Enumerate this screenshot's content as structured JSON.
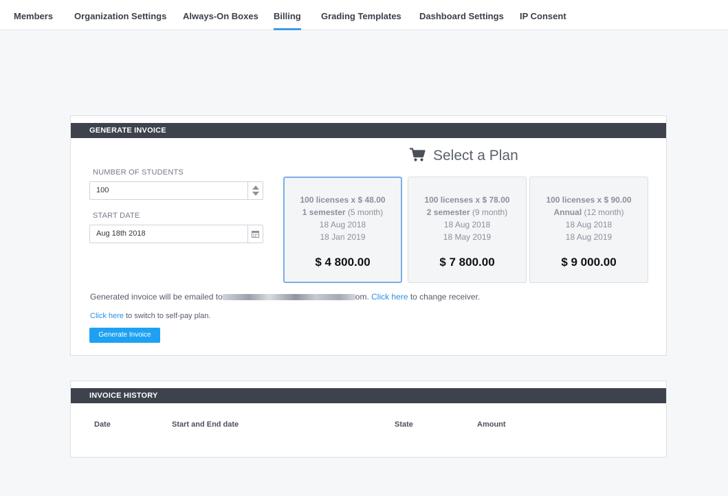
{
  "nav": {
    "tabs": [
      {
        "label": "Members"
      },
      {
        "label": "Organization Settings"
      },
      {
        "label": "Always-On Boxes"
      },
      {
        "label": "Billing",
        "active": true
      },
      {
        "label": "Grading Templates"
      },
      {
        "label": "Dashboard Settings"
      },
      {
        "label": "IP Consent"
      }
    ]
  },
  "generate_invoice": {
    "header": "GENERATE INVOICE",
    "students_label": "NUMBER OF STUDENTS",
    "students_value": "100",
    "start_date_label": "START DATE",
    "start_date_value": "Aug 18th 2018",
    "select_plan_title": "Select a Plan",
    "plans": [
      {
        "licenses": "100 licenses x $ 48.00",
        "term": "1 semester",
        "term_note": " (5 month)",
        "start": "18 Aug 2018",
        "end": "18 Jan 2019",
        "price": "$ 4 800.00",
        "selected": true
      },
      {
        "licenses": "100 licenses x $ 78.00",
        "term": "2 semester",
        "term_note": " (9 month)",
        "start": "18 Aug 2018",
        "end": "18 May 2019",
        "price": "$ 7 800.00",
        "selected": false
      },
      {
        "licenses": "100 licenses x $ 90.00",
        "term": "Annual",
        "term_note": " (12 month)",
        "start": "18 Aug 2018",
        "end": "18 Aug 2019",
        "price": "$ 9 000.00",
        "selected": false
      }
    ],
    "email_prefix": "Generated invoice will be emailed to",
    "email_suffix": "om.",
    "click_here_receiver": "Click here",
    "receiver_suffix": " to change receiver.",
    "click_here_selfpay": "Click here",
    "selfpay_suffix": " to switch to self-pay plan.",
    "generate_button": "Generate Invoice"
  },
  "invoice_history": {
    "header": "INVOICE HISTORY",
    "columns": [
      "Date",
      "Start and End date",
      "State",
      "Amount"
    ]
  },
  "icons": {
    "cart": "shopping-cart-icon",
    "calendar": "calendar-icon",
    "spinner": "number-stepper-icon"
  },
  "colors": {
    "accent": "#3d9be9",
    "header_bar": "#3d424c",
    "button": "#1ea1f2",
    "link": "#2a8fe0"
  }
}
